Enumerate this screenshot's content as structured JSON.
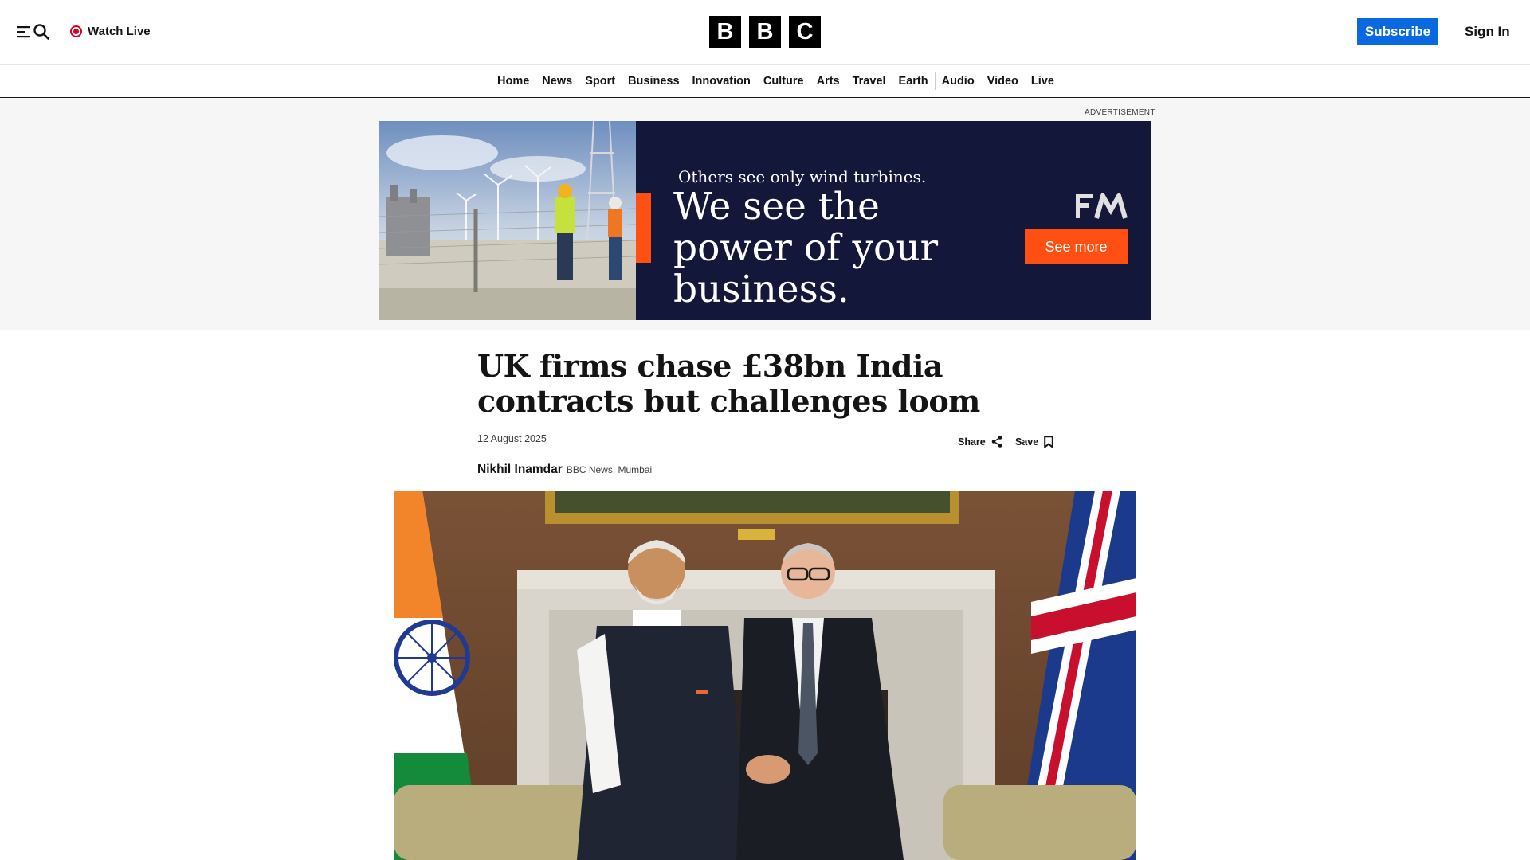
{
  "header": {
    "watch_live_label": "Watch Live",
    "logo_letters": [
      "B",
      "B",
      "C"
    ],
    "subscribe_label": "Subscribe",
    "signin_label": "Sign In"
  },
  "nav": {
    "items": [
      "Home",
      "News",
      "Sport",
      "Business",
      "Innovation",
      "Culture",
      "Arts",
      "Travel",
      "Earth",
      "Audio",
      "Video",
      "Live"
    ]
  },
  "ad": {
    "label": "ADVERTISEMENT",
    "small_text": "Others see only wind turbines.",
    "big_text": "We see the power of your business.",
    "cta_label": "See more"
  },
  "article": {
    "headline": "UK firms chase £38bn India contracts but challenges loom",
    "date": "12 August 2025",
    "share_label": "Share",
    "save_label": "Save",
    "author": "Nikhil Inamdar",
    "author_org": "BBC News, Mumbai"
  },
  "colors": {
    "brand_blue": "#0a68e0",
    "live_red": "#d4001f",
    "ad_navy": "#13173a",
    "ad_orange": "#ff4f12"
  },
  "icons": {
    "menu": "menu-icon",
    "search": "search-icon",
    "live": "live-dot-icon",
    "share": "share-icon",
    "save": "bookmark-icon"
  }
}
